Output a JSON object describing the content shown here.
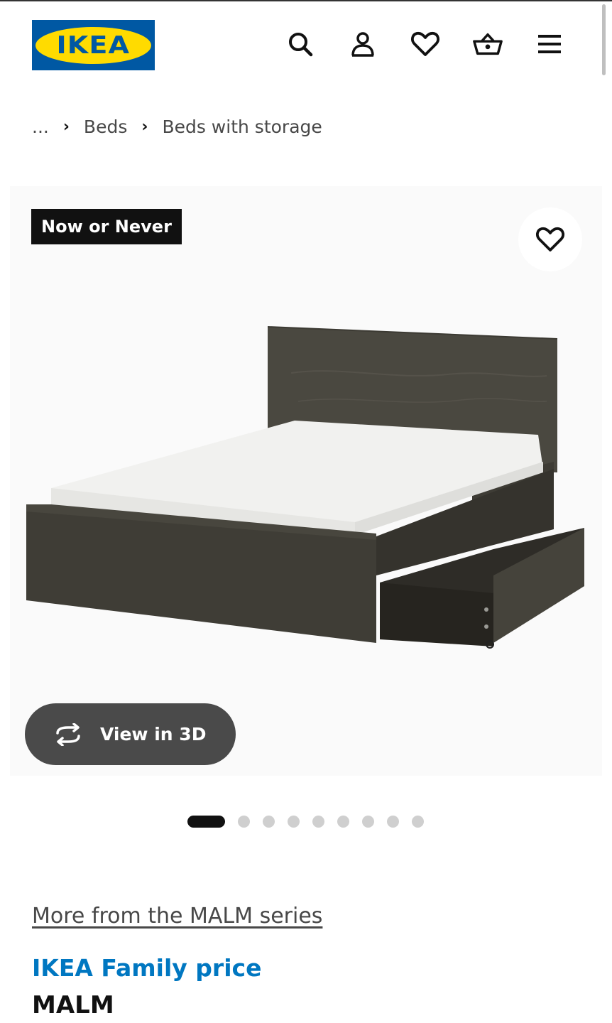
{
  "header": {
    "logo_text": "IKEA",
    "icons": [
      "search-icon",
      "user-icon",
      "heart-icon",
      "basket-icon",
      "menu-icon"
    ]
  },
  "breadcrumb": {
    "ellipsis": "...",
    "items": [
      "Beds",
      "Beds with storage"
    ]
  },
  "gallery": {
    "promo_badge": "Now or Never",
    "view_3d_label": "View in 3D",
    "image_count": 9,
    "active_index": 0
  },
  "product": {
    "series_link": "More from the MALM series",
    "price_label": "IKEA Family price",
    "name": "MALM"
  },
  "colors": {
    "ikea_blue": "#0058a3",
    "ikea_yellow": "#ffdb00",
    "family_blue": "#0077c1"
  }
}
